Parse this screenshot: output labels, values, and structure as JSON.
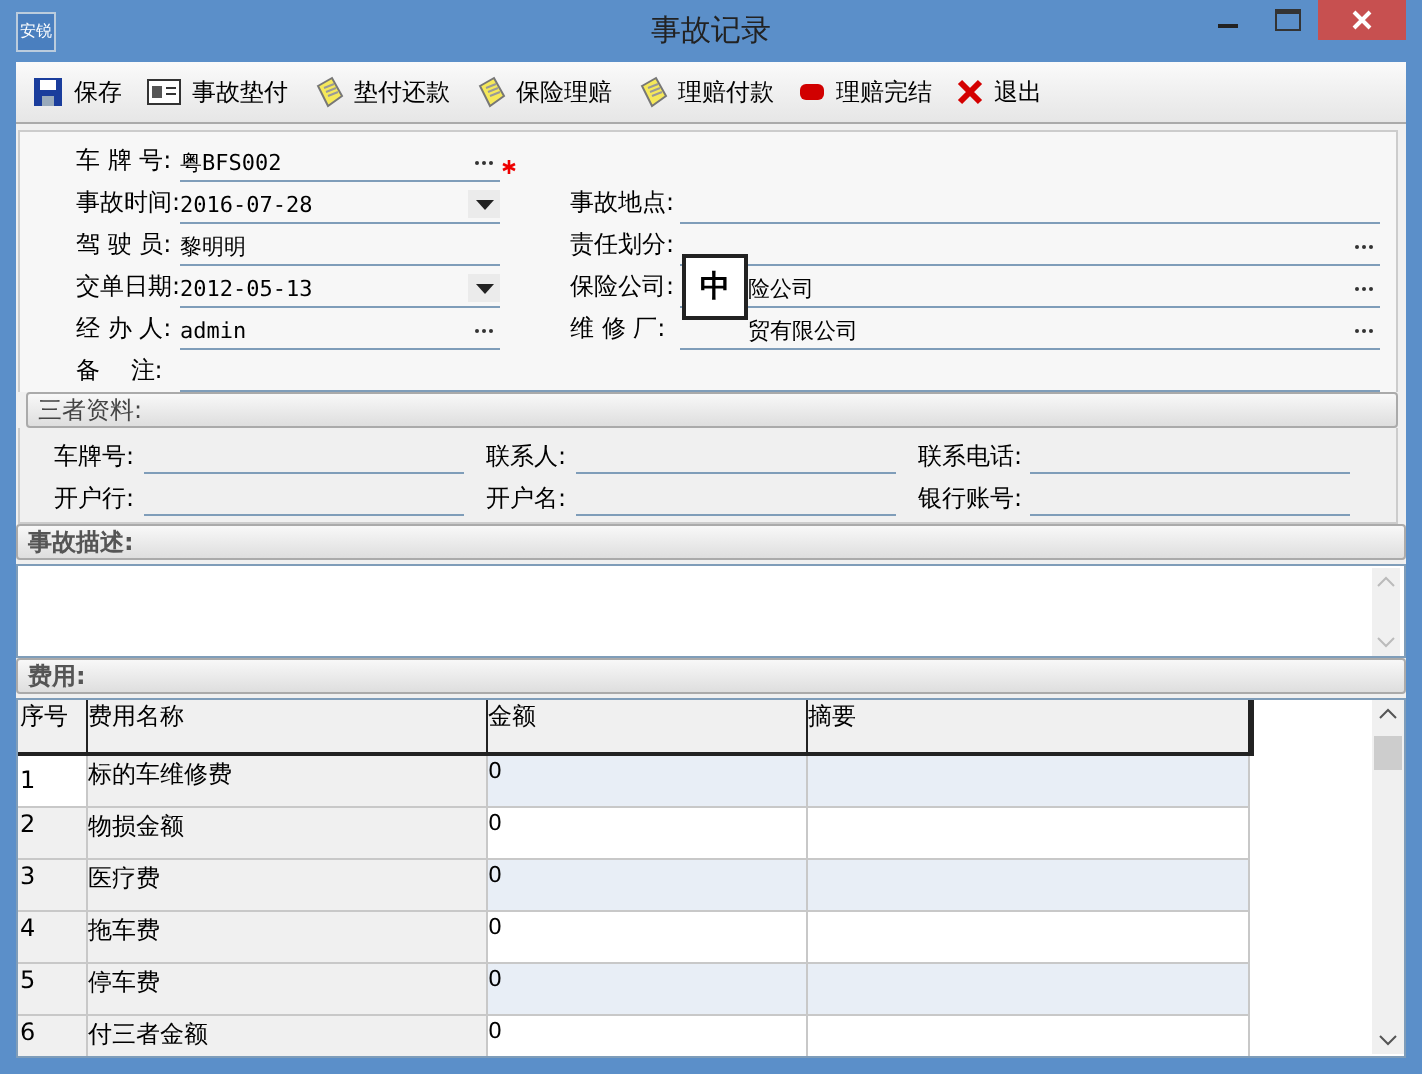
{
  "window": {
    "title": "事故记录",
    "app_icon": "安锐"
  },
  "toolbar": [
    {
      "kind": "save",
      "label": "保存"
    },
    {
      "kind": "card",
      "label": "事故垫付"
    },
    {
      "kind": "note",
      "label": "垫付还款"
    },
    {
      "kind": "note",
      "label": "保险理赔"
    },
    {
      "kind": "note",
      "label": "理赔付款"
    },
    {
      "kind": "stop",
      "label": "理赔完结"
    },
    {
      "kind": "exit",
      "label": "退出"
    }
  ],
  "form": {
    "rows": [
      {
        "left": {
          "label": "车 牌 号:",
          "value": "粤BFS002",
          "kind": "lookup",
          "required": true
        },
        "right": null
      },
      {
        "left": {
          "label": "事故时间:",
          "value": "2016-07-28",
          "kind": "date",
          "required": false
        },
        "right": {
          "label": "事故地点:",
          "kind": "text",
          "required": false
        }
      },
      {
        "left": {
          "label": "驾 驶 员:",
          "value": "黎明明",
          "kind": "text",
          "required": false
        },
        "right": {
          "label": "责任划分:",
          "kind": "lookup",
          "required": false
        }
      },
      {
        "left": {
          "label": "交单日期:",
          "value": "2012-05-13",
          "kind": "date",
          "required": false
        },
        "right": {
          "label": "保险公司:",
          "value": "险公司",
          "kind": "lookup",
          "required": false
        }
      },
      {
        "left": {
          "label": "经 办 人:",
          "value": "admin",
          "kind": "lookup",
          "required": false
        },
        "right": {
          "label": "维 修 厂:",
          "value": "贸有限公司",
          "kind": "lookup",
          "required": false
        }
      }
    ],
    "remark": {
      "label": "备    注:"
    }
  },
  "ime_indicator": "中",
  "third_party": {
    "title": "三者资料:",
    "fields": [
      {
        "label": "车牌号:"
      },
      {
        "label": "联系人:"
      },
      {
        "label": "联系电话:"
      },
      {
        "label": "开户行:"
      },
      {
        "label": "开户名:"
      },
      {
        "label": "银行账号:"
      }
    ]
  },
  "description": {
    "title": "事故描述:"
  },
  "fees": {
    "title": "费用:",
    "columns": [
      "序号",
      "费用名称",
      "金额",
      "摘要"
    ],
    "rows": [
      {
        "no": "1",
        "name": "标的车维修费",
        "amount": "0",
        "selected": true
      },
      {
        "no": "2",
        "name": "物损金额",
        "amount": "0",
        "selected": false
      },
      {
        "no": "3",
        "name": "医疗费",
        "amount": "0",
        "selected": false
      },
      {
        "no": "4",
        "name": "拖车费",
        "amount": "0",
        "selected": false
      },
      {
        "no": "5",
        "name": "停车费",
        "amount": "0",
        "selected": false
      },
      {
        "no": "6",
        "name": "付三者金额",
        "amount": "0",
        "selected": false
      }
    ]
  }
}
